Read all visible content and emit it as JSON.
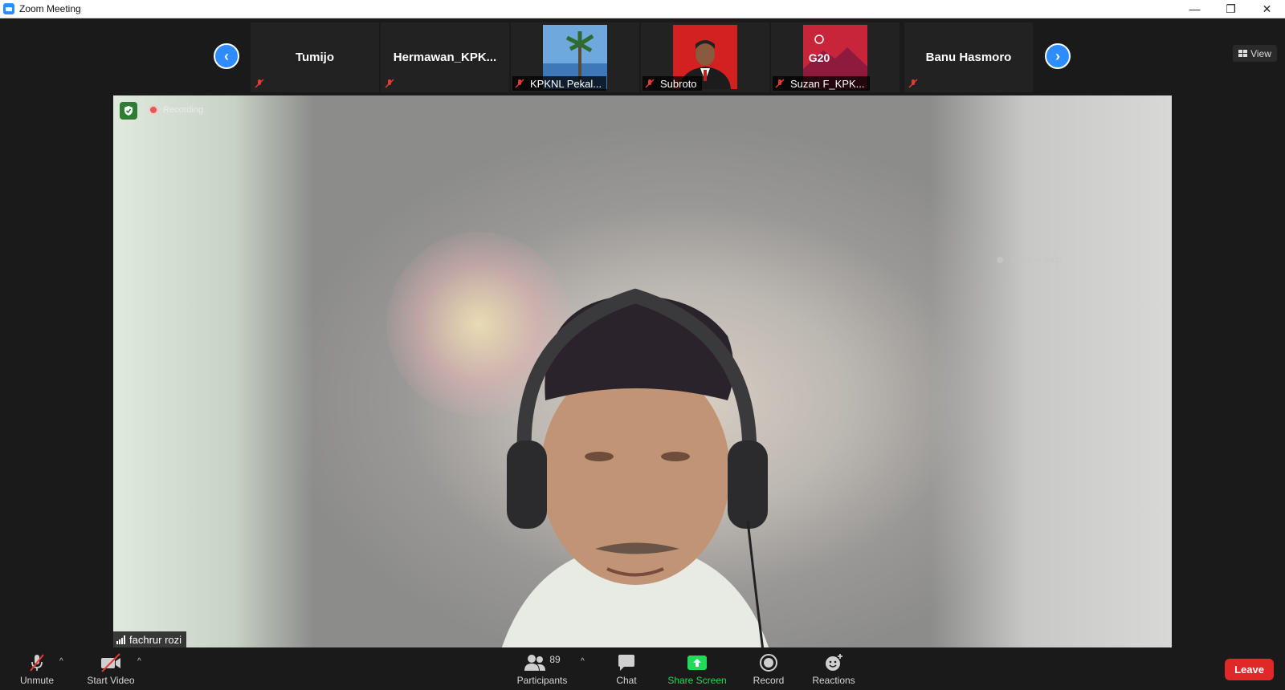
{
  "window": {
    "title": "Zoom Meeting",
    "app_icon": "zoom-icon"
  },
  "gallery": {
    "tiles": [
      {
        "name": "Tumijo",
        "has_video": false
      },
      {
        "name": "Hermawan_KPK...",
        "has_video": false
      },
      {
        "name": "KPKNL Pekal...",
        "has_video": true
      },
      {
        "name": "Subroto",
        "has_video": true
      },
      {
        "name": "Suzan F_KPK...",
        "has_video": true
      },
      {
        "name": "Banu Hasmoro",
        "has_video": false
      }
    ],
    "view_label": "View"
  },
  "main_video": {
    "recording_label": "Recording",
    "window_snip_label": "Window Snip",
    "speaker_name": "fachrur rozi"
  },
  "toolbar": {
    "unmute": "Unmute",
    "start_video": "Start Video",
    "participants": "Participants",
    "participants_count": "89",
    "chat": "Chat",
    "share_screen": "Share Screen",
    "record": "Record",
    "reactions": "Reactions",
    "leave": "Leave"
  },
  "colors": {
    "accent": "#2d8cff",
    "leave": "#e02828",
    "share": "#23d959",
    "muted": "#e53935"
  }
}
